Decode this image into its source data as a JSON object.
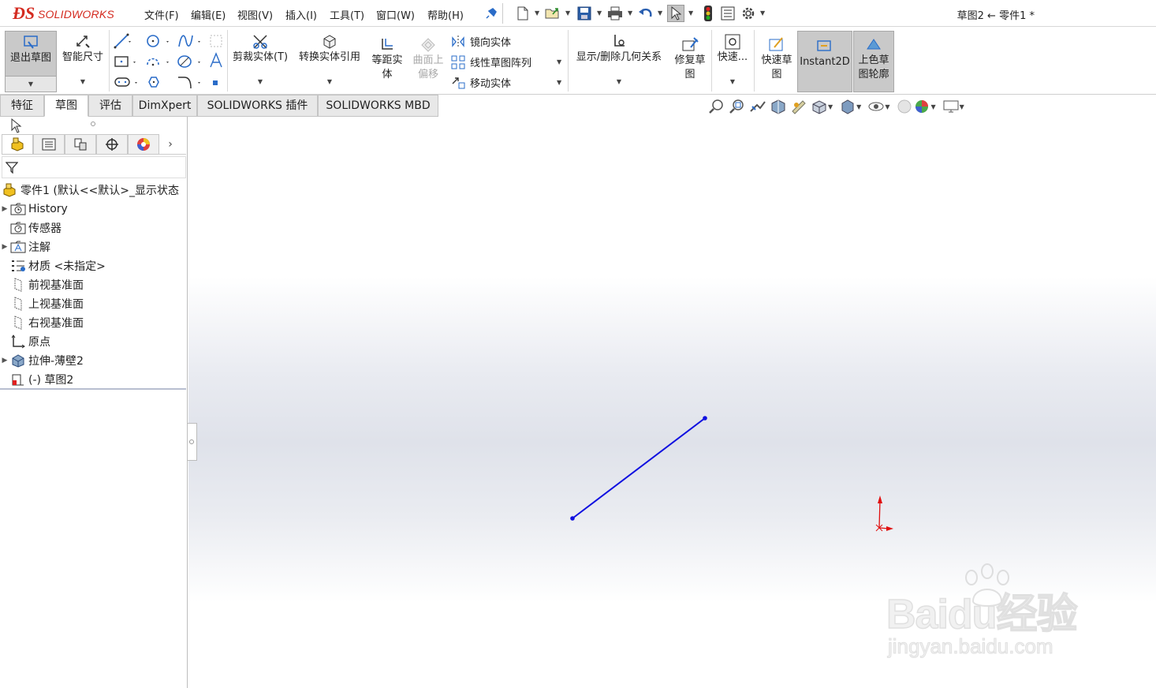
{
  "app": {
    "brand_prefix": "SOLID",
    "brand_suffix": "WORKS",
    "window_title": "草图2 ← 零件1 *"
  },
  "menu": [
    "文件(F)",
    "编辑(E)",
    "视图(V)",
    "插入(I)",
    "工具(T)",
    "窗口(W)",
    "帮助(H)"
  ],
  "ribbon": {
    "exit_sketch": "退出草图",
    "smart_dimension": "智能尺寸",
    "trim_entities": "剪裁实体(T)",
    "convert_entities": "转换实体引用",
    "offset_line1": "等距实",
    "offset_line2": "体",
    "surface_offset_line1": "曲面上",
    "surface_offset_line2": "偏移",
    "mirror_entities": "镜向实体",
    "linear_pattern": "线性草图阵列",
    "move_entities": "移动实体",
    "display_relations": "显示/删除几何关系",
    "repair_line1": "修复草",
    "repair_line2": "图",
    "quick_snaps": "快速...",
    "rapid_line1": "快速草",
    "rapid_line2": "图",
    "instant2d": "Instant2D",
    "shaded_line1": "上色草",
    "shaded_line2": "图轮廓"
  },
  "tabs": [
    "特征",
    "草图",
    "评估",
    "DimXpert",
    "SOLIDWORKS 插件",
    "SOLIDWORKS MBD"
  ],
  "active_tab": "草图",
  "tree": {
    "root": "零件1 (默认<<默认>_显示状态",
    "items": [
      {
        "label": "History",
        "icon": "history-folder-icon",
        "expandable": true
      },
      {
        "label": "传感器",
        "icon": "sensor-icon",
        "expandable": false
      },
      {
        "label": "注解",
        "icon": "annotation-icon",
        "expandable": true
      },
      {
        "label": "材质 <未指定>",
        "icon": "material-icon",
        "expandable": false
      },
      {
        "label": "前视基准面",
        "icon": "plane-icon",
        "expandable": false
      },
      {
        "label": "上视基准面",
        "icon": "plane-icon",
        "expandable": false
      },
      {
        "label": "右视基准面",
        "icon": "plane-icon",
        "expandable": false
      },
      {
        "label": "原点",
        "icon": "origin-icon",
        "expandable": false
      },
      {
        "label": "拉伸-薄壁2",
        "icon": "extrude-icon",
        "expandable": true
      },
      {
        "label": "(-) 草图2",
        "icon": "sketch-icon",
        "expandable": false
      }
    ]
  },
  "colors": {
    "sketch_line": "#1010e0",
    "origin": "#e01010",
    "brand": "#d42b20"
  },
  "watermark": {
    "main": "Baidu经验",
    "sub": "jingyan.baidu.com"
  }
}
